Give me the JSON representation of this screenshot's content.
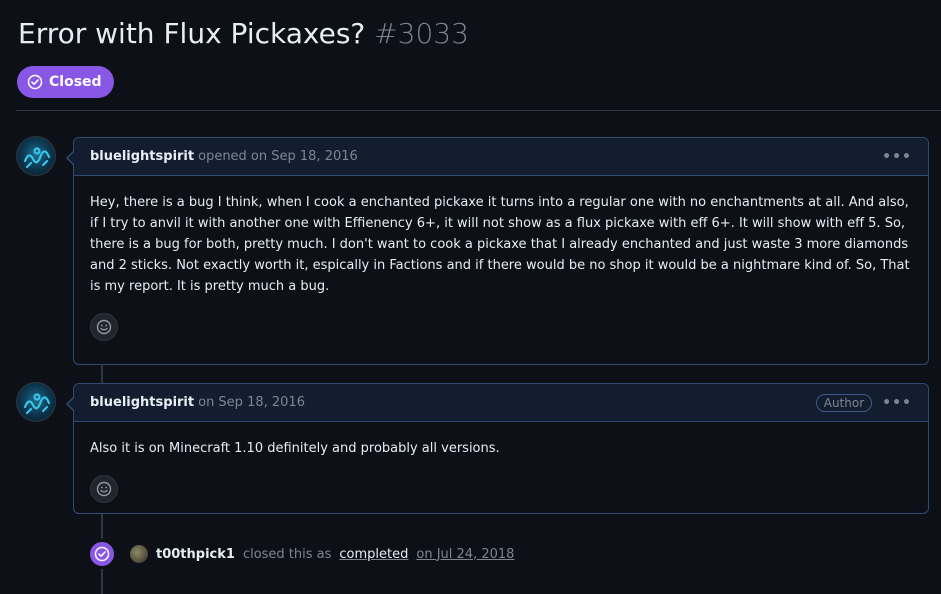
{
  "issue": {
    "title": "Error with Flux Pickaxes?",
    "number": "#3033",
    "state": "Closed",
    "state_color": "#8957e5"
  },
  "comments": [
    {
      "author": "bluelightspirit",
      "meta": "opened on Sep 18, 2016",
      "body": "Hey, there is a bug I think, when I cook a enchanted pickaxe it turns into a regular one with no enchantments at all. And also, if I try to anvil it with another one with Effienency 6+, it will not show as a flux pickaxe with eff 6+. It will show with eff 5. So, there is a bug for both, pretty much. I don't want to cook a pickaxe that I already enchanted and just waste 3 more diamonds and 2 sticks. Not exactly worth it, espically in Factions and if there would be no shop it would be a nightmare kind of. So, That is my report. It is pretty much a bug.",
      "menu": "•••"
    },
    {
      "author": "bluelightspirit",
      "meta": "on Sep 18, 2016",
      "role_label": "Author",
      "body": "Also it is on Minecraft 1.10 definitely and probably all versions.",
      "menu": "•••"
    }
  ],
  "event": {
    "actor": "t00thpick1",
    "text": "closed this as",
    "reason": "completed",
    "date": "on Jul 24, 2018"
  },
  "icons": {
    "state": "check-circle-icon",
    "reaction": "smiley-icon",
    "event": "check-circle-icon"
  }
}
